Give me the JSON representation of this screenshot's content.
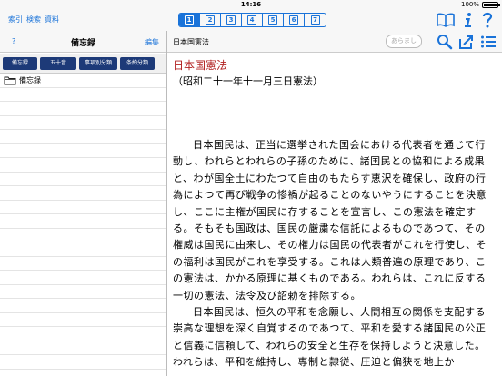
{
  "statusbar": {
    "time": "14:16",
    "battery": "100%",
    "battery_level": 1.0
  },
  "topmenu": [
    "索引",
    "検索",
    "資料"
  ],
  "volume_tabs": [
    {
      "num": "1",
      "active": true
    },
    {
      "num": "2",
      "active": false
    },
    {
      "num": "3",
      "active": false
    },
    {
      "num": "4",
      "active": false
    },
    {
      "num": "5",
      "active": false
    },
    {
      "num": "6",
      "active": false
    },
    {
      "num": "7",
      "active": false
    }
  ],
  "left_header": {
    "help": "?",
    "title": "備忘録",
    "edit": "編集"
  },
  "filters": [
    "備忘録",
    "五十音",
    "事項別分類",
    "条約分類"
  ],
  "list": {
    "folder_label": "備忘録"
  },
  "right_header": {
    "doc_title": "日本国憲法",
    "summary_button": "あらまし"
  },
  "content": {
    "title": "日本国憲法",
    "date": "（昭和二十一年十一月三日憲法）",
    "preamble": "日本国民は、正当に選挙された国会における代表者を通じて行動し、われらとわれらの子孫のために、諸国民との協和による成果と、わが国全土にわたつて自由のもたらす恵沢を確保し、政府の行為によつて再び戦争の惨禍が起ることのないやうにすることを決意し、ここに主権が国民に存することを宣言し、この憲法を確定する。そもそも国政は、国民の厳粛な信託によるものであつて、その権威は国民に由来し、その権力は国民の代表者がこれを行使し、その福利は国民がこれを享受する。これは人類普遍の原理であり、この憲法は、かかる原理に基くものである。われらは、これに反する一切の憲法、法令及び詔勅を排除する。",
    "preamble2": "日本国民は、恒久の平和を念願し、人間相互の関係を支配する崇高な理想を深く自覚するのであつて、平和を愛する諸国民の公正と信義に信頼して、われらの安全と生存を保持しようと決意した。われらは、平和を維持し、専制と隷従、圧迫と偏狭を地上か"
  }
}
